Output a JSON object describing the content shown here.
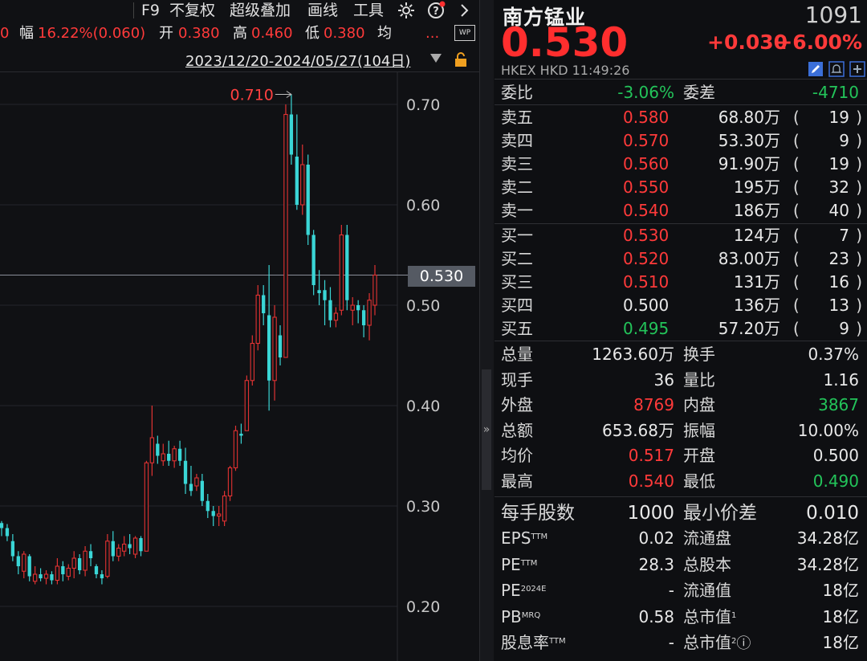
{
  "toolbar": {
    "f9": "F9",
    "no_restore": "不复权",
    "overlay": "超级叠加",
    "draw": "画线",
    "tools": "工具"
  },
  "infobar": {
    "prev_fragment": "0",
    "amp_label": "幅",
    "amp_value": "16.22%(0.060)",
    "open_label": "开",
    "open_value": "0.380",
    "high_label": "高",
    "high_value": "0.460",
    "low_label": "低",
    "low_value": "0.380",
    "avg_label": "均",
    "more": "...",
    "wp_badge": "WP"
  },
  "date_range": "2023/12/20-2024/05/27(104日)",
  "chart": {
    "max_label": "0.710",
    "current_price_tag": "0.530",
    "colors": {
      "up": "#e03232",
      "down": "#3ad6d6",
      "grid": "#23252b"
    }
  },
  "chart_data": {
    "type": "candlestick",
    "y_ticks": [
      "0.70",
      "0.60",
      "0.50",
      "0.40",
      "0.30",
      "0.20"
    ],
    "ylim": [
      0.165,
      0.735
    ],
    "max_marker": 0.71,
    "current": 0.53,
    "candles": [
      {
        "o": 0.283,
        "h": 0.285,
        "l": 0.27,
        "c": 0.278
      },
      {
        "o": 0.278,
        "h": 0.282,
        "l": 0.265,
        "c": 0.27
      },
      {
        "o": 0.265,
        "h": 0.272,
        "l": 0.245,
        "c": 0.25
      },
      {
        "o": 0.25,
        "h": 0.255,
        "l": 0.232,
        "c": 0.24
      },
      {
        "o": 0.235,
        "h": 0.255,
        "l": 0.228,
        "c": 0.252
      },
      {
        "o": 0.25,
        "h": 0.252,
        "l": 0.225,
        "c": 0.23
      },
      {
        "o": 0.225,
        "h": 0.24,
        "l": 0.222,
        "c": 0.232
      },
      {
        "o": 0.232,
        "h": 0.238,
        "l": 0.225,
        "c": 0.228
      },
      {
        "o": 0.228,
        "h": 0.236,
        "l": 0.222,
        "c": 0.232
      },
      {
        "o": 0.232,
        "h": 0.235,
        "l": 0.222,
        "c": 0.226
      },
      {
        "o": 0.226,
        "h": 0.248,
        "l": 0.222,
        "c": 0.24
      },
      {
        "o": 0.24,
        "h": 0.245,
        "l": 0.225,
        "c": 0.232
      },
      {
        "o": 0.23,
        "h": 0.242,
        "l": 0.226,
        "c": 0.238
      },
      {
        "o": 0.238,
        "h": 0.255,
        "l": 0.228,
        "c": 0.248
      },
      {
        "o": 0.248,
        "h": 0.252,
        "l": 0.232,
        "c": 0.236
      },
      {
        "o": 0.236,
        "h": 0.26,
        "l": 0.23,
        "c": 0.255
      },
      {
        "o": 0.255,
        "h": 0.262,
        "l": 0.24,
        "c": 0.248
      },
      {
        "o": 0.24,
        "h": 0.242,
        "l": 0.228,
        "c": 0.232
      },
      {
        "o": 0.232,
        "h": 0.236,
        "l": 0.222,
        "c": 0.228
      },
      {
        "o": 0.23,
        "h": 0.272,
        "l": 0.228,
        "c": 0.265
      },
      {
        "o": 0.265,
        "h": 0.275,
        "l": 0.245,
        "c": 0.25
      },
      {
        "o": 0.25,
        "h": 0.262,
        "l": 0.245,
        "c": 0.258
      },
      {
        "o": 0.255,
        "h": 0.27,
        "l": 0.25,
        "c": 0.262
      },
      {
        "o": 0.262,
        "h": 0.272,
        "l": 0.252,
        "c": 0.258
      },
      {
        "o": 0.252,
        "h": 0.27,
        "l": 0.248,
        "c": 0.268
      },
      {
        "o": 0.268,
        "h": 0.27,
        "l": 0.25,
        "c": 0.255
      },
      {
        "o": 0.255,
        "h": 0.345,
        "l": 0.255,
        "c": 0.343
      },
      {
        "o": 0.343,
        "h": 0.4,
        "l": 0.33,
        "c": 0.368
      },
      {
        "o": 0.362,
        "h": 0.37,
        "l": 0.342,
        "c": 0.35
      },
      {
        "o": 0.345,
        "h": 0.362,
        "l": 0.34,
        "c": 0.352
      },
      {
        "o": 0.352,
        "h": 0.365,
        "l": 0.34,
        "c": 0.345
      },
      {
        "o": 0.345,
        "h": 0.36,
        "l": 0.338,
        "c": 0.357
      },
      {
        "o": 0.357,
        "h": 0.365,
        "l": 0.34,
        "c": 0.345
      },
      {
        "o": 0.345,
        "h": 0.358,
        "l": 0.312,
        "c": 0.322
      },
      {
        "o": 0.322,
        "h": 0.34,
        "l": 0.31,
        "c": 0.315
      },
      {
        "o": 0.32,
        "h": 0.332,
        "l": 0.315,
        "c": 0.328
      },
      {
        "o": 0.325,
        "h": 0.332,
        "l": 0.3,
        "c": 0.305
      },
      {
        "o": 0.305,
        "h": 0.312,
        "l": 0.288,
        "c": 0.295
      },
      {
        "o": 0.295,
        "h": 0.3,
        "l": 0.28,
        "c": 0.29
      },
      {
        "o": 0.29,
        "h": 0.3,
        "l": 0.28,
        "c": 0.292
      },
      {
        "o": 0.285,
        "h": 0.315,
        "l": 0.28,
        "c": 0.31
      },
      {
        "o": 0.31,
        "h": 0.34,
        "l": 0.305,
        "c": 0.338
      },
      {
        "o": 0.338,
        "h": 0.38,
        "l": 0.335,
        "c": 0.375
      },
      {
        "o": 0.372,
        "h": 0.382,
        "l": 0.362,
        "c": 0.37
      },
      {
        "o": 0.375,
        "h": 0.43,
        "l": 0.375,
        "c": 0.425
      },
      {
        "o": 0.425,
        "h": 0.47,
        "l": 0.42,
        "c": 0.462
      },
      {
        "o": 0.462,
        "h": 0.52,
        "l": 0.455,
        "c": 0.51
      },
      {
        "o": 0.51,
        "h": 0.52,
        "l": 0.48,
        "c": 0.492
      },
      {
        "o": 0.49,
        "h": 0.54,
        "l": 0.395,
        "c": 0.425
      },
      {
        "o": 0.425,
        "h": 0.5,
        "l": 0.405,
        "c": 0.488
      },
      {
        "o": 0.47,
        "h": 0.48,
        "l": 0.44,
        "c": 0.448
      },
      {
        "o": 0.448,
        "h": 0.7,
        "l": 0.448,
        "c": 0.69
      },
      {
        "o": 0.69,
        "h": 0.71,
        "l": 0.64,
        "c": 0.65
      },
      {
        "o": 0.648,
        "h": 0.69,
        "l": 0.595,
        "c": 0.6
      },
      {
        "o": 0.6,
        "h": 0.66,
        "l": 0.59,
        "c": 0.64
      },
      {
        "o": 0.64,
        "h": 0.65,
        "l": 0.56,
        "c": 0.57
      },
      {
        "o": 0.57,
        "h": 0.575,
        "l": 0.51,
        "c": 0.52
      },
      {
        "o": 0.515,
        "h": 0.535,
        "l": 0.5,
        "c": 0.512
      },
      {
        "o": 0.515,
        "h": 0.525,
        "l": 0.48,
        "c": 0.505
      },
      {
        "o": 0.505,
        "h": 0.518,
        "l": 0.478,
        "c": 0.485
      },
      {
        "o": 0.485,
        "h": 0.498,
        "l": 0.478,
        "c": 0.492
      },
      {
        "o": 0.495,
        "h": 0.58,
        "l": 0.49,
        "c": 0.57
      },
      {
        "o": 0.57,
        "h": 0.58,
        "l": 0.495,
        "c": 0.505
      },
      {
        "o": 0.495,
        "h": 0.508,
        "l": 0.48,
        "c": 0.5
      },
      {
        "o": 0.5,
        "h": 0.505,
        "l": 0.482,
        "c": 0.495
      },
      {
        "o": 0.495,
        "h": 0.5,
        "l": 0.468,
        "c": 0.48
      },
      {
        "o": 0.48,
        "h": 0.512,
        "l": 0.465,
        "c": 0.505
      },
      {
        "o": 0.5,
        "h": 0.54,
        "l": 0.49,
        "c": 0.53
      }
    ]
  },
  "quote": {
    "name": "南方锰业",
    "code": "1091",
    "price": "0.530",
    "change": "+0.030",
    "change_pct": "+6.00%",
    "exchange_line": "HKEX  HKD  11:49:26",
    "commission_ratio_label": "委比",
    "commission_ratio_value": "-3.06%",
    "commission_diff_label": "委差",
    "commission_diff_value": "-4710",
    "asks": [
      {
        "label": "卖五",
        "price": "0.580",
        "vol": "68.80万",
        "count": "19",
        "color": "red"
      },
      {
        "label": "卖四",
        "price": "0.570",
        "vol": "53.30万",
        "count": "9",
        "color": "red"
      },
      {
        "label": "卖三",
        "price": "0.560",
        "vol": "91.90万",
        "count": "19",
        "color": "red"
      },
      {
        "label": "卖二",
        "price": "0.550",
        "vol": "195万",
        "count": "32",
        "color": "red"
      },
      {
        "label": "卖一",
        "price": "0.540",
        "vol": "186万",
        "count": "40",
        "color": "red"
      }
    ],
    "bids": [
      {
        "label": "买一",
        "price": "0.530",
        "vol": "124万",
        "count": "7",
        "color": "red"
      },
      {
        "label": "买二",
        "price": "0.520",
        "vol": "83.00万",
        "count": "23",
        "color": "red"
      },
      {
        "label": "买三",
        "price": "0.510",
        "vol": "131万",
        "count": "16",
        "color": "red"
      },
      {
        "label": "买四",
        "price": "0.500",
        "vol": "136万",
        "count": "13",
        "color": "white"
      },
      {
        "label": "买五",
        "price": "0.495",
        "vol": "57.20万",
        "count": "9",
        "color": "green"
      }
    ],
    "paren_open": "(",
    "paren_close": ")",
    "stats": [
      {
        "l1": "总量",
        "v1": "1263.60万",
        "c1": "white",
        "l2": "换手",
        "v2": "0.37%",
        "c2": "white"
      },
      {
        "l1": "现手",
        "v1": "36",
        "c1": "white",
        "l2": "量比",
        "v2": "1.16",
        "c2": "white"
      },
      {
        "l1": "外盘",
        "v1": "8769",
        "c1": "red",
        "l2": "内盘",
        "v2": "3867",
        "c2": "green"
      },
      {
        "l1": "总额",
        "v1": "653.68万",
        "c1": "white",
        "l2": "振幅",
        "v2": "10.00%",
        "c2": "white"
      },
      {
        "l1": "均价",
        "v1": "0.517",
        "c1": "red",
        "l2": "开盘",
        "v2": "0.500",
        "c2": "white"
      },
      {
        "l1": "最高",
        "v1": "0.540",
        "c1": "red",
        "l2": "最低",
        "v2": "0.490",
        "c2": "green"
      }
    ],
    "lot_label": "每手股数",
    "lot_value": "1000",
    "tick_label": "最小价差",
    "tick_value": "0.010",
    "fundamentals": [
      {
        "l1": "EPS",
        "s1": "TTM",
        "v1": "0.02",
        "l2": "流通盘",
        "s2": "",
        "v2": "34.28亿"
      },
      {
        "l1": "PE",
        "s1": "TTM",
        "v1": "28.3",
        "l2": "总股本",
        "s2": "",
        "v2": "34.28亿"
      },
      {
        "l1": "PE",
        "s1": "2024E",
        "v1": "-",
        "l2": "流通值",
        "s2": "",
        "v2": "18亿"
      },
      {
        "l1": "PB",
        "s1": "MRQ",
        "v1": "0.58",
        "l2": "总市值",
        "s2": "1",
        "v2": "18亿"
      },
      {
        "l1": "股息率",
        "s1": "TTM",
        "v1": "-",
        "l2": "总市值",
        "s2": "2",
        "v2": "18亿"
      }
    ],
    "info_mark": "ⓘ"
  },
  "collapse_glyph": "»"
}
